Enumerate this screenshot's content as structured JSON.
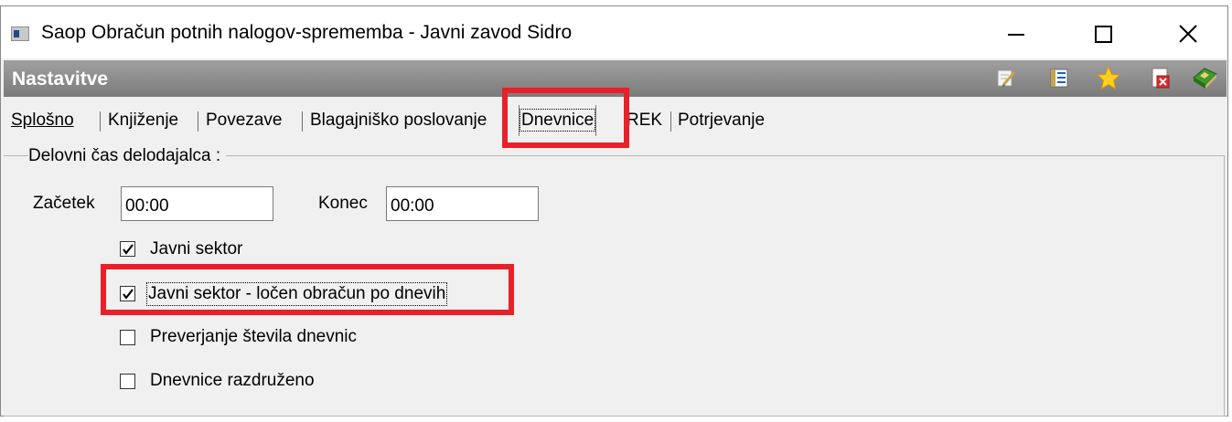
{
  "window": {
    "title": "Saop Obračun potnih nalogov-sprememba - Javni zavod Sidro"
  },
  "header": {
    "title": "Nastavitve",
    "tools": [
      "edit-icon",
      "list-icon",
      "star-icon",
      "close-document-icon",
      "exit-book-icon"
    ]
  },
  "tabs": [
    {
      "label": "Splošno"
    },
    {
      "label": "Knjiženje"
    },
    {
      "label": "Povezave"
    },
    {
      "label": "Blagajniško poslovanje"
    },
    {
      "label": "Dnevnice",
      "active": true
    },
    {
      "label": "REK"
    },
    {
      "label": "Potrjevanje"
    }
  ],
  "group": {
    "label": "Delovni čas delodajalca :"
  },
  "fields": {
    "start_label": "Začetek",
    "start_value": "00:00",
    "end_label": "Konec",
    "end_value": "00:00"
  },
  "checkboxes": [
    {
      "label": "Javni sektor",
      "checked": true
    },
    {
      "label": "Javni sektor - ločen obračun po dnevih",
      "checked": true
    },
    {
      "label": "Preverjanje števila dnevnic",
      "checked": false
    },
    {
      "label": "Dnevnice razdruženo",
      "checked": false
    }
  ],
  "colors": {
    "highlight": "#e8202a",
    "header_bar": "#8a8a8a"
  }
}
